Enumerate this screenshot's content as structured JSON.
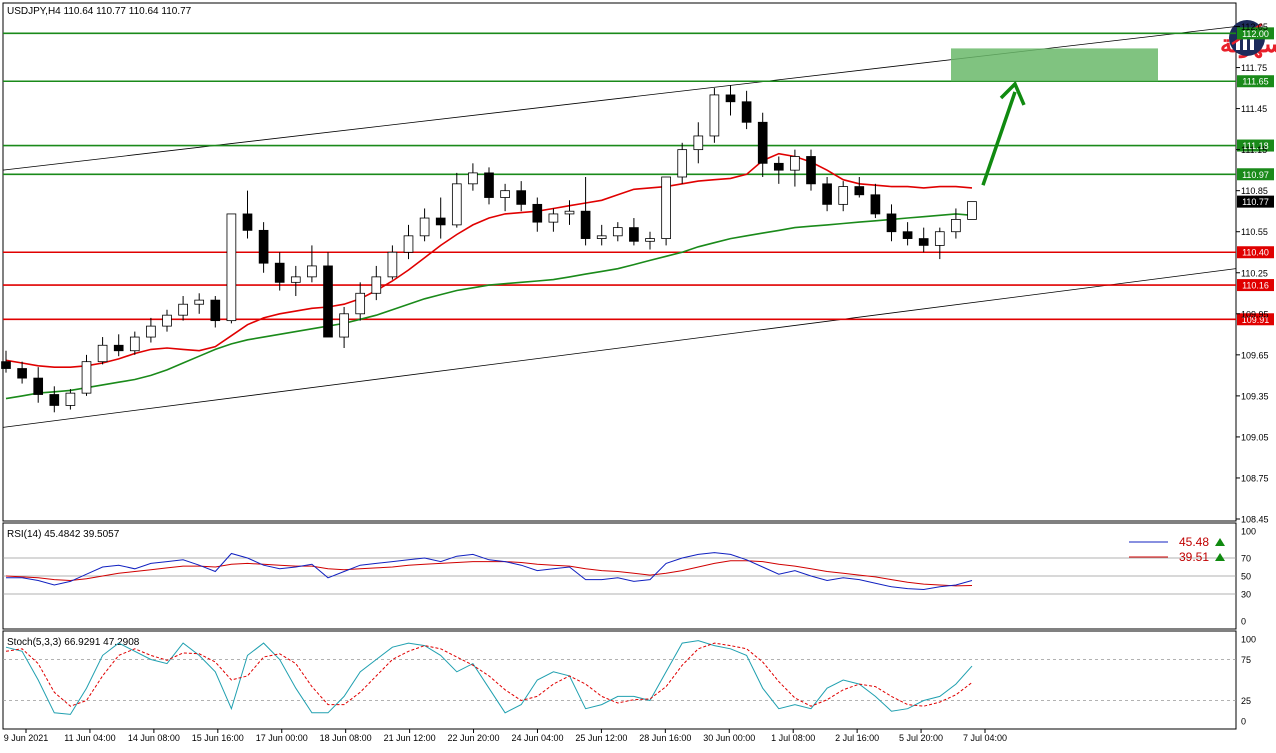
{
  "header": {
    "symbol_info": "USDJPY,H4  110.64 110.77 110.64 110.77"
  },
  "logo": {
    "text": "التداول بسهولة",
    "colors": {
      "red": "#e8202a",
      "navy": "#1d2b5b"
    }
  },
  "colors": {
    "bull": "#ffffff",
    "bear": "#000000",
    "level_green": "#1a8a1a",
    "level_red": "#e00000",
    "ma_fast": "#e00000",
    "ma_slow": "#1a8a1a",
    "target_zone": "#6ab86a",
    "arrow": "#108a10",
    "rsi_line": "#1020c0",
    "rsi_signal": "#d00000",
    "stoch_main": "#20a0b0",
    "stoch_signal": "#e00000"
  },
  "chart_data": [
    {
      "type": "candlestick",
      "symbol": "USDJPY",
      "timeframe": "H4",
      "ylim": [
        108.45,
        112.2
      ],
      "y_ticks": [
        "112.05",
        "111.75",
        "111.45",
        "111.15",
        "110.85",
        "110.55",
        "110.25",
        "109.95",
        "109.65",
        "109.35",
        "109.05",
        "108.75",
        "108.45"
      ],
      "x_ticks": [
        "9 Jun 2021",
        "11 Jun 04:00",
        "14 Jun 08:00",
        "15 Jun 16:00",
        "17 Jun 00:00",
        "18 Jun 08:00",
        "21 Jun 12:00",
        "22 Jun 20:00",
        "24 Jun 04:00",
        "25 Jun 12:00",
        "28 Jun 16:00",
        "30 Jun 00:00",
        "1 Jul 08:00",
        "2 Jul 16:00",
        "5 Jul 20:00",
        "7 Jul 04:00"
      ],
      "horizontal_levels": [
        {
          "label": "112.00",
          "value": 112.0,
          "color": "green"
        },
        {
          "label": "111.65",
          "value": 111.65,
          "color": "green"
        },
        {
          "label": "111.18",
          "value": 111.18,
          "color": "green"
        },
        {
          "label": "110.97",
          "value": 110.97,
          "color": "green"
        },
        {
          "label": "110.40",
          "value": 110.4,
          "color": "red"
        },
        {
          "label": "110.16",
          "value": 110.16,
          "color": "red"
        },
        {
          "label": "109.91",
          "value": 109.91,
          "color": "red"
        }
      ],
      "current_price": {
        "label": "110.77",
        "value": 110.77
      },
      "target_zone": {
        "value_from": 111.65,
        "value_to": 111.89
      },
      "channel": {
        "upper": [
          111.0,
          112.05
        ],
        "lower": [
          109.12,
          110.28
        ]
      },
      "ma_fast": [
        109.61,
        109.59,
        109.57,
        109.56,
        109.56,
        109.57,
        109.59,
        109.62,
        109.66,
        109.69,
        109.7,
        109.69,
        109.68,
        109.71,
        109.79,
        109.87,
        109.92,
        109.95,
        109.97,
        109.99,
        110.0,
        110.02,
        110.06,
        110.12,
        110.19,
        110.27,
        110.36,
        110.45,
        110.53,
        110.6,
        110.65,
        110.68,
        110.69,
        110.7,
        110.72,
        110.74,
        110.76,
        110.78,
        110.82,
        110.86,
        110.87,
        110.88,
        110.9,
        110.92,
        110.93,
        110.94,
        110.97,
        111.07,
        111.12,
        111.1,
        111.06,
        111.0,
        110.93,
        110.9,
        110.89,
        110.88,
        110.88,
        110.87,
        110.88,
        110.88,
        110.87
      ],
      "ma_slow": [
        109.33,
        109.35,
        109.37,
        109.38,
        109.39,
        109.41,
        109.43,
        109.45,
        109.47,
        109.5,
        109.54,
        109.59,
        109.64,
        109.69,
        109.73,
        109.76,
        109.78,
        109.8,
        109.82,
        109.84,
        109.86,
        109.88,
        109.91,
        109.94,
        109.98,
        110.02,
        110.06,
        110.09,
        110.12,
        110.14,
        110.16,
        110.17,
        110.18,
        110.19,
        110.2,
        110.22,
        110.24,
        110.26,
        110.28,
        110.31,
        110.34,
        110.37,
        110.4,
        110.44,
        110.47,
        110.5,
        110.52,
        110.54,
        110.56,
        110.58,
        110.59,
        110.6,
        110.61,
        110.62,
        110.63,
        110.64,
        110.65,
        110.66,
        110.67,
        110.68,
        110.67
      ],
      "ohlc": [
        [
          109.6,
          109.68,
          109.52,
          109.55
        ],
        [
          109.55,
          109.6,
          109.44,
          109.48
        ],
        [
          109.48,
          109.56,
          109.3,
          109.36
        ],
        [
          109.36,
          109.42,
          109.23,
          109.28
        ],
        [
          109.28,
          109.4,
          109.25,
          109.37
        ],
        [
          109.37,
          109.65,
          109.35,
          109.6
        ],
        [
          109.6,
          109.78,
          109.58,
          109.72
        ],
        [
          109.72,
          109.8,
          109.64,
          109.68
        ],
        [
          109.68,
          109.82,
          109.65,
          109.78
        ],
        [
          109.78,
          109.92,
          109.74,
          109.86
        ],
        [
          109.86,
          109.98,
          109.82,
          109.94
        ],
        [
          109.94,
          110.08,
          109.9,
          110.02
        ],
        [
          110.02,
          110.1,
          109.95,
          110.05
        ],
        [
          110.05,
          110.08,
          109.85,
          109.9
        ],
        [
          109.9,
          110.25,
          109.88,
          110.68
        ],
        [
          110.68,
          110.85,
          110.5,
          110.56
        ],
        [
          110.56,
          110.62,
          110.25,
          110.32
        ],
        [
          110.32,
          110.4,
          110.12,
          110.18
        ],
        [
          110.18,
          110.3,
          110.08,
          110.22
        ],
        [
          110.22,
          110.45,
          110.18,
          110.3
        ],
        [
          110.3,
          110.4,
          110.0,
          109.78
        ],
        [
          109.78,
          110.0,
          109.7,
          109.95
        ],
        [
          109.95,
          110.18,
          109.9,
          110.1
        ],
        [
          110.1,
          110.3,
          110.05,
          110.22
        ],
        [
          110.22,
          110.45,
          110.2,
          110.4
        ],
        [
          110.4,
          110.6,
          110.35,
          110.52
        ],
        [
          110.52,
          110.72,
          110.48,
          110.65
        ],
        [
          110.65,
          110.8,
          110.5,
          110.6
        ],
        [
          110.6,
          110.98,
          110.58,
          110.9
        ],
        [
          110.9,
          111.05,
          110.85,
          110.98
        ],
        [
          110.98,
          111.02,
          110.75,
          110.8
        ],
        [
          110.8,
          110.9,
          110.7,
          110.85
        ],
        [
          110.85,
          110.92,
          110.7,
          110.75
        ],
        [
          110.75,
          110.8,
          110.55,
          110.62
        ],
        [
          110.62,
          110.72,
          110.55,
          110.68
        ],
        [
          110.68,
          110.78,
          110.6,
          110.7
        ],
        [
          110.7,
          110.95,
          110.45,
          110.5
        ],
        [
          110.5,
          110.6,
          110.45,
          110.52
        ],
        [
          110.52,
          110.62,
          110.48,
          110.58
        ],
        [
          110.58,
          110.65,
          110.45,
          110.48
        ],
        [
          110.48,
          110.55,
          110.42,
          110.5
        ],
        [
          110.5,
          110.95,
          110.45,
          110.95
        ],
        [
          110.95,
          111.2,
          110.9,
          111.15
        ],
        [
          111.15,
          111.35,
          111.05,
          111.25
        ],
        [
          111.25,
          111.6,
          111.2,
          111.55
        ],
        [
          111.55,
          111.62,
          111.4,
          111.5
        ],
        [
          111.5,
          111.58,
          111.3,
          111.35
        ],
        [
          111.35,
          111.42,
          110.95,
          111.05
        ],
        [
          111.05,
          111.1,
          110.9,
          111.0
        ],
        [
          111.0,
          111.15,
          110.88,
          111.1
        ],
        [
          111.1,
          111.15,
          110.85,
          110.9
        ],
        [
          110.9,
          110.95,
          110.7,
          110.75
        ],
        [
          110.75,
          110.92,
          110.7,
          110.88
        ],
        [
          110.88,
          110.95,
          110.8,
          110.82
        ],
        [
          110.82,
          110.9,
          110.65,
          110.68
        ],
        [
          110.68,
          110.75,
          110.48,
          110.55
        ],
        [
          110.55,
          110.62,
          110.45,
          110.5
        ],
        [
          110.5,
          110.58,
          110.4,
          110.45
        ],
        [
          110.45,
          110.58,
          110.35,
          110.55
        ],
        [
          110.55,
          110.72,
          110.5,
          110.64
        ],
        [
          110.64,
          110.77,
          110.64,
          110.77
        ]
      ]
    },
    {
      "type": "line",
      "title": "RSI(14) 45.4842 39.5057",
      "ylim": [
        0,
        100
      ],
      "y_ticks": [
        "100",
        "70",
        "50",
        "30",
        "0"
      ],
      "levels": [
        70,
        50,
        30
      ],
      "legend_values": [
        "45.48",
        "39.51"
      ],
      "rsi": [
        48,
        48,
        45,
        40,
        44,
        52,
        60,
        62,
        58,
        64,
        66,
        68,
        62,
        55,
        75,
        70,
        62,
        58,
        60,
        63,
        48,
        55,
        62,
        64,
        66,
        68,
        70,
        66,
        72,
        74,
        68,
        66,
        62,
        56,
        58,
        60,
        46,
        46,
        48,
        44,
        46,
        64,
        70,
        74,
        76,
        74,
        68,
        60,
        52,
        56,
        50,
        45,
        48,
        46,
        42,
        38,
        36,
        35,
        38,
        40,
        45
      ],
      "signal": [
        50,
        49,
        48,
        46,
        45,
        47,
        50,
        53,
        55,
        57,
        59,
        61,
        61,
        60,
        63,
        64,
        63,
        62,
        61,
        61,
        58,
        57,
        58,
        59,
        60,
        62,
        63,
        64,
        65,
        66,
        66,
        66,
        65,
        63,
        62,
        61,
        58,
        56,
        55,
        53,
        51,
        53,
        56,
        60,
        64,
        67,
        67,
        66,
        63,
        61,
        58,
        55,
        53,
        51,
        49,
        46,
        43,
        41,
        40,
        39,
        39.5
      ]
    },
    {
      "type": "line",
      "title": "Stoch(5,3,3) 66.9291 47.2908",
      "ylim": [
        0,
        100
      ],
      "y_ticks": [
        "100",
        "75",
        "25",
        "0"
      ],
      "levels": [
        75,
        25
      ],
      "main": [
        90,
        85,
        50,
        10,
        8,
        40,
        80,
        95,
        85,
        75,
        70,
        95,
        80,
        60,
        15,
        80,
        95,
        75,
        40,
        10,
        10,
        30,
        60,
        75,
        90,
        95,
        92,
        80,
        60,
        70,
        40,
        10,
        20,
        50,
        60,
        55,
        15,
        20,
        30,
        30,
        25,
        60,
        95,
        98,
        92,
        88,
        80,
        40,
        15,
        20,
        15,
        40,
        50,
        45,
        30,
        12,
        15,
        25,
        30,
        45,
        67
      ],
      "signal": [
        85,
        88,
        70,
        35,
        18,
        25,
        55,
        80,
        88,
        80,
        74,
        83,
        82,
        72,
        50,
        55,
        78,
        82,
        70,
        42,
        20,
        20,
        35,
        55,
        75,
        85,
        92,
        88,
        78,
        68,
        55,
        38,
        25,
        30,
        45,
        55,
        45,
        30,
        22,
        26,
        27,
        42,
        68,
        88,
        95,
        92,
        88,
        72,
        48,
        28,
        18,
        26,
        38,
        45,
        42,
        30,
        20,
        18,
        23,
        32,
        47
      ]
    }
  ]
}
